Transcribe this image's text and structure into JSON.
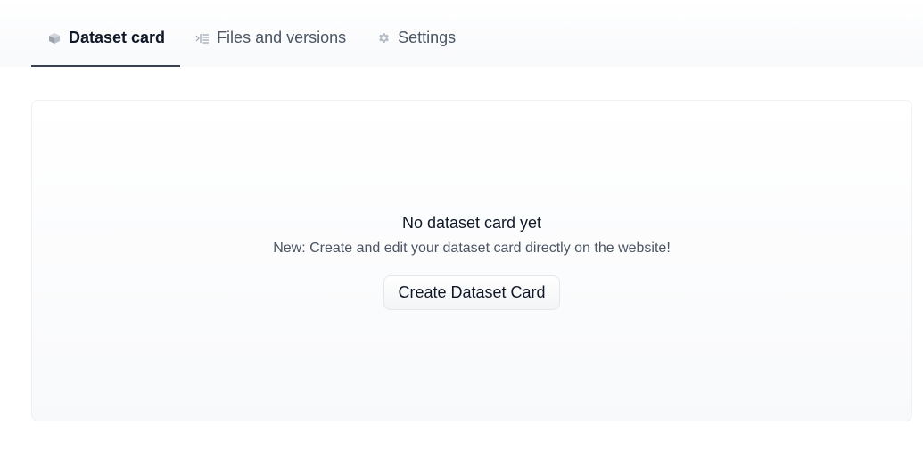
{
  "tabs": [
    {
      "label": "Dataset card",
      "icon": "cube-icon",
      "active": true
    },
    {
      "label": "Files and versions",
      "icon": "file-tree-icon",
      "active": false
    },
    {
      "label": "Settings",
      "icon": "gear-icon",
      "active": false
    }
  ],
  "empty_state": {
    "title": "No dataset card yet",
    "subtitle": "New: Create and edit your dataset card directly on the website!",
    "button_label": "Create Dataset Card"
  },
  "colors": {
    "active_underline": "#374151",
    "icon_gray": "#9ca3af"
  }
}
